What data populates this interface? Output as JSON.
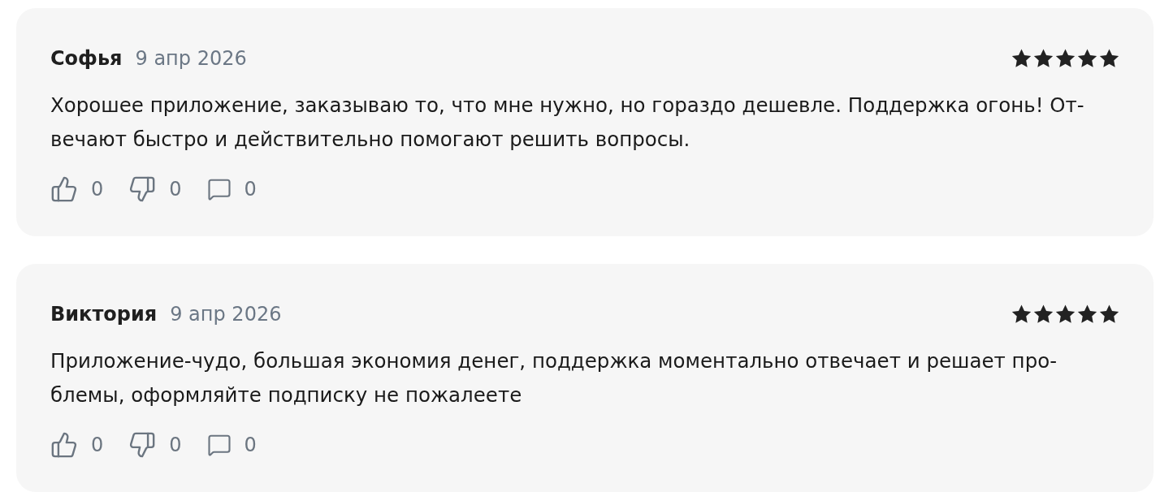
{
  "reviews": [
    {
      "author": "Софья",
      "date": "9 апр 2026",
      "stars": 5,
      "text": "Хорошее приложение, заказываю то, что мне нужно, но гораздо дешевле. Поддержка огонь! От-\nвечают быстро и действительно помогают решить вопросы.",
      "likes": "0",
      "dislikes": "0",
      "comments": "0"
    },
    {
      "author": "Виктория",
      "date": "9 апр 2026",
      "stars": 5,
      "text": "Приложение-чудо, большая экономия денег, поддержка моментально отвечает и решает про-\nблемы, оформляйте подписку не пожалеете",
      "likes": "0",
      "dislikes": "0",
      "comments": "0"
    }
  ]
}
